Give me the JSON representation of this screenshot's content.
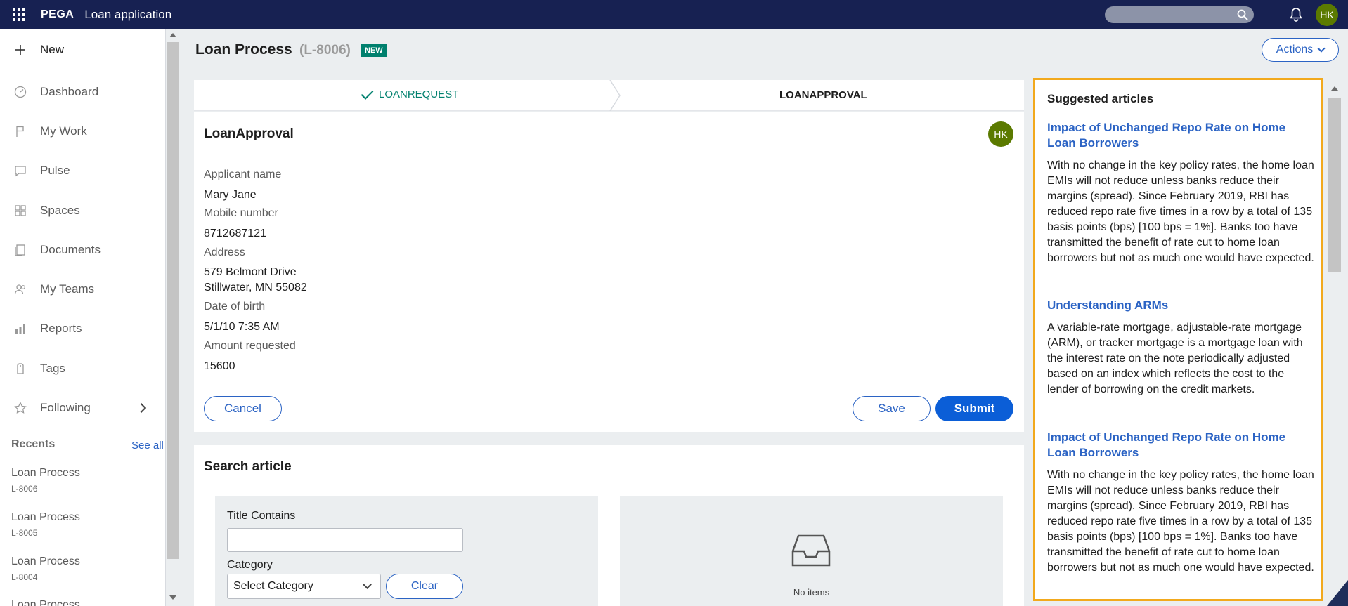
{
  "topbar": {
    "brand": "PEGA",
    "app_title": "Loan application",
    "user_initials": "HK"
  },
  "sidebar": {
    "new_label": "New",
    "items": [
      {
        "label": "Dashboard",
        "icon": "dashboard-icon"
      },
      {
        "label": "My Work",
        "icon": "flag-icon"
      },
      {
        "label": "Pulse",
        "icon": "chat-icon"
      },
      {
        "label": "Spaces",
        "icon": "grid-icon"
      },
      {
        "label": "Documents",
        "icon": "document-icon"
      },
      {
        "label": "My Teams",
        "icon": "team-icon"
      },
      {
        "label": "Reports",
        "icon": "bar-chart-icon"
      },
      {
        "label": "Tags",
        "icon": "tag-icon"
      },
      {
        "label": "Following",
        "icon": "star-icon"
      }
    ],
    "recents_heading": "Recents",
    "see_all": "See all",
    "recents": [
      {
        "title": "Loan Process",
        "id": "L-8006"
      },
      {
        "title": "Loan Process",
        "id": "L-8005"
      },
      {
        "title": "Loan Process",
        "id": "L-8004"
      },
      {
        "title": "Loan Process",
        "id": ""
      }
    ]
  },
  "header": {
    "case_title": "Loan Process",
    "case_id": "(L-8006)",
    "badge": "NEW",
    "actions_label": "Actions"
  },
  "stages": {
    "completed": "LOANREQUEST",
    "current": "LOANAPPROVAL"
  },
  "assignment": {
    "title": "LoanApproval",
    "avatar": "HK",
    "fields": {
      "applicant_label": "Applicant name",
      "applicant_value": "Mary Jane",
      "mobile_label": "Mobile number",
      "mobile_value": "8712687121",
      "address_label": "Address",
      "address_line1": "579 Belmont Drive",
      "address_line2": "Stillwater, MN 55082",
      "dob_label": "Date of birth",
      "dob_value": "5/1/10 7:35 AM",
      "amount_label": "Amount requested",
      "amount_value": "15600"
    },
    "cancel": "Cancel",
    "save": "Save",
    "submit": "Submit"
  },
  "search_article": {
    "title": "Search article",
    "title_contains_label": "Title Contains",
    "title_contains_value": "",
    "category_label": "Category",
    "category_value": "Select Category",
    "clear": "Clear",
    "no_items": "No items"
  },
  "suggested": {
    "heading": "Suggested articles",
    "articles": [
      {
        "title": "Impact of Unchanged Repo Rate on Home Loan Borrowers",
        "body": "With no change in the key policy rates, the home loan EMIs will not reduce unless banks reduce their margins (spread). Since February 2019, RBI has reduced repo rate five times in a row by a total of 135 basis points (bps) [100 bps = 1%]. Banks too have transmitted the benefit of rate cut to home loan borrowers but not as much one would have expected."
      },
      {
        "title": "Understanding ARMs",
        "body": "A variable-rate mortgage, adjustable-rate mortgage (ARM), or tracker mortgage is a mortgage loan with the interest rate on the note periodically adjusted based on an index which reflects the cost to the lender of borrowing on the credit markets."
      },
      {
        "title": "Impact of Unchanged Repo Rate on Home Loan Borrowers",
        "body": "With no change in the key policy rates, the home loan EMIs will not reduce unless banks reduce their margins (spread). Since February 2019, RBI has reduced repo rate five times in a row by a total of 135 basis points (bps) [100 bps = 1%]. Banks too have transmitted the benefit of rate cut to home loan borrowers but not as much one would have expected."
      }
    ]
  },
  "colors": {
    "topbar": "#172152",
    "accent": "#2b63c4",
    "primary_button": "#0b5ed7",
    "highlight_border": "#f2a91d",
    "success": "#00806e"
  }
}
